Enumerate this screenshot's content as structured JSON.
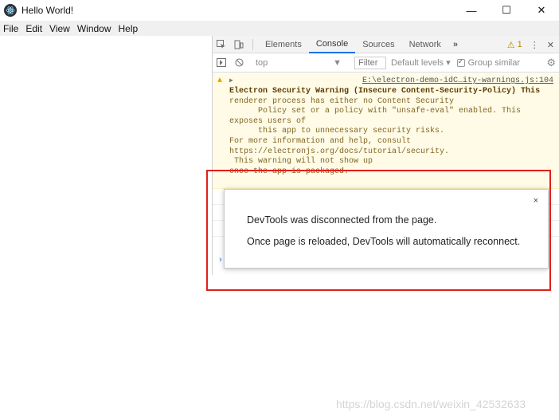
{
  "window": {
    "title": "Hello World!",
    "controls": {
      "minimize": "—",
      "maximize": "☐",
      "close": "✕"
    }
  },
  "menu": [
    "File",
    "Edit",
    "View",
    "Window",
    "Help"
  ],
  "devtools": {
    "tabs": [
      "Elements",
      "Console",
      "Sources",
      "Network"
    ],
    "active_tab": "Console",
    "more_tabs": "»",
    "warning_count": "1",
    "context_select": "top",
    "filter_placeholder": "Filter",
    "levels": "Default levels ▾",
    "group_similar": "Group similar",
    "warning": {
      "source": "E:\\electron-demo-idC…ity-warnings.js:104",
      "title": "Electron Security Warning (Insecure Content-Security-Policy) This",
      "lines": [
        "renderer process has either no Content Security",
        "      Policy set or a policy with \"unsafe-eval\" enabled. This",
        "exposes users of",
        "      this app to unnecessary security risks.",
        "",
        "For more information and help, consult",
        "https://electronjs.org/docs/tutorial/security.",
        " This warning will not show up",
        "once the app is packaged."
      ]
    },
    "prompt": "›"
  },
  "dialog": {
    "close": "×",
    "message_1": "DevTools was disconnected from the page.",
    "message_2": "Once page is reloaded, DevTools will automatically reconnect."
  },
  "watermark": "https://blog.csdn.net/weixin_42532633",
  "colors": {
    "highlight": "#e0201a",
    "warning_bg": "#fffbe6",
    "accent": "#1a73e8"
  }
}
